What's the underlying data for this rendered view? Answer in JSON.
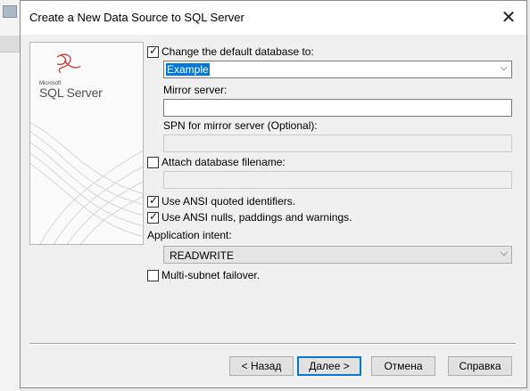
{
  "dialog": {
    "title": "Create a New Data Source to SQL Server",
    "logo_small": "Microsoft",
    "logo_text": "SQL Server"
  },
  "options": {
    "change_default_db_label": "Change the default database to:",
    "change_default_db_checked": true,
    "default_db_value": "Example",
    "mirror_server_label": "Mirror server:",
    "mirror_server_value": "",
    "spn_label": "SPN for mirror server (Optional):",
    "spn_value": "",
    "attach_db_label": "Attach database filename:",
    "attach_db_checked": false,
    "attach_db_value": "",
    "ansi_quoted_label": "Use ANSI quoted identifiers.",
    "ansi_quoted_checked": true,
    "ansi_nulls_label": "Use ANSI nulls, paddings and warnings.",
    "ansi_nulls_checked": true,
    "app_intent_label": "Application intent:",
    "app_intent_value": "READWRITE",
    "multisubnet_label": "Multi-subnet failover.",
    "multisubnet_checked": false
  },
  "buttons": {
    "back": "< Назад",
    "next": "Далее >",
    "cancel": "Отмена",
    "help": "Справка"
  },
  "icons": {
    "close": "close-icon",
    "check": "checkmark-icon",
    "dropdown": "chevron-down-icon"
  }
}
